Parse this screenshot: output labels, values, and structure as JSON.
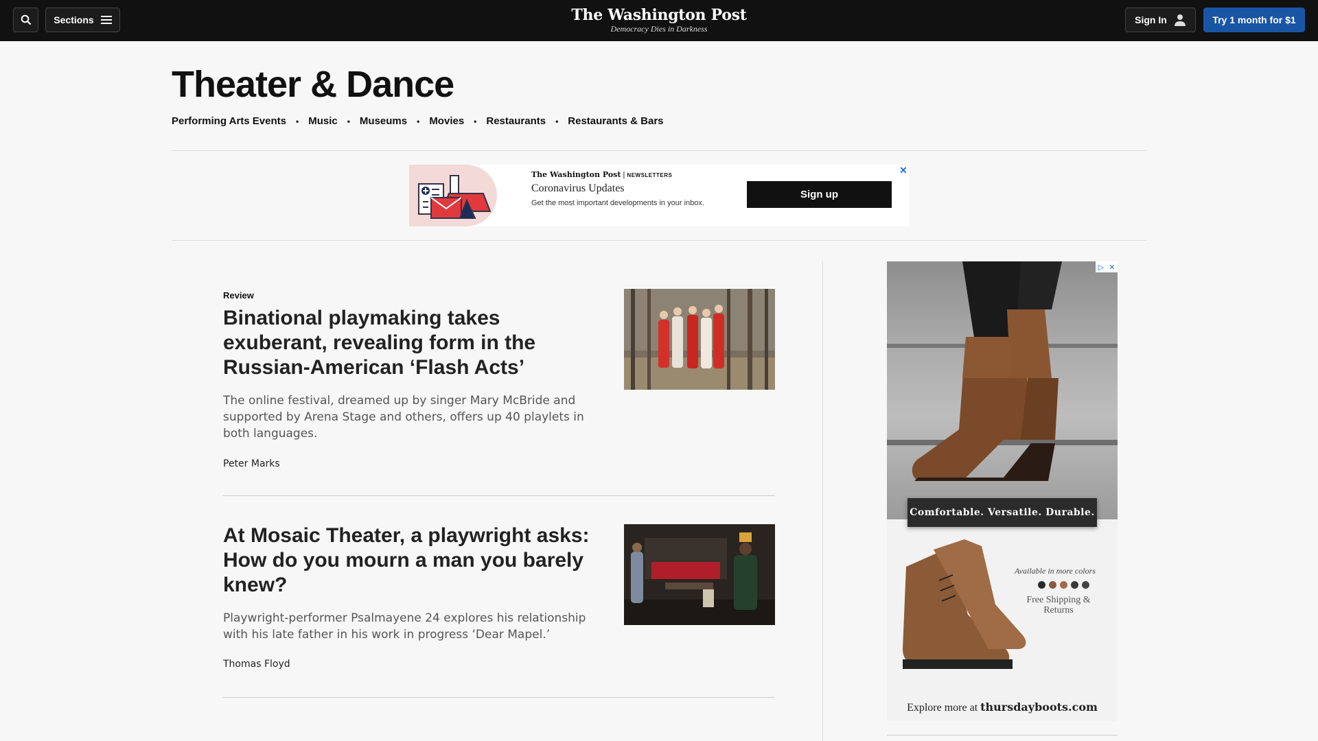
{
  "topbar": {
    "sections_label": "Sections",
    "logo_name": "The Washington Post",
    "logo_tagline": "Democracy Dies in Darkness",
    "signin_label": "Sign In",
    "try_label": "Try 1 month for $1"
  },
  "section": {
    "title": "Theater & Dance",
    "subnav": [
      "Performing Arts Events",
      "Music",
      "Museums",
      "Movies",
      "Restaurants",
      "Restaurants & Bars"
    ]
  },
  "newsletter_ad": {
    "brand": "The Washington Post",
    "brand_suffix": "NEWSLETTERS",
    "title": "Coronavirus Updates",
    "description": "Get the most important developments in your inbox.",
    "button_label": "Sign up",
    "close_glyph": "✕"
  },
  "articles": [
    {
      "kicker": "Review",
      "headline": "Binational playmaking takes exuberant, revealing form in the Russian-American ‘Flash Acts’",
      "blurb": "The online festival, dreamed up by singer Mary McBride and supported by Arena Stage and others, offers up 40 playlets in both languages.",
      "byline": "Peter Marks"
    },
    {
      "kicker": "",
      "headline": "At Mosaic Theater, a playwright asks: How do you mourn a man you barely knew?",
      "blurb": "Playwright-performer Psalmayene 24 explores his relationship with his late father in his work in progress ‘Dear Mapel.’",
      "byline": "Thomas Floyd"
    }
  ],
  "boot_ad": {
    "caption": "Comfortable. Versatile. Durable.",
    "available": "Available in more colors",
    "shipping": "Free Shipping & Returns",
    "explore_prefix": "Explore more at",
    "explore_site": "thursdayboots.com",
    "swatch_colors": [
      "#2a2a2a",
      "#8b5a3c",
      "#a26b4b",
      "#3a3a3a",
      "#444444"
    ]
  },
  "colors": {
    "topbar_bg": "#111111",
    "accent_blue": "#1955a5"
  }
}
